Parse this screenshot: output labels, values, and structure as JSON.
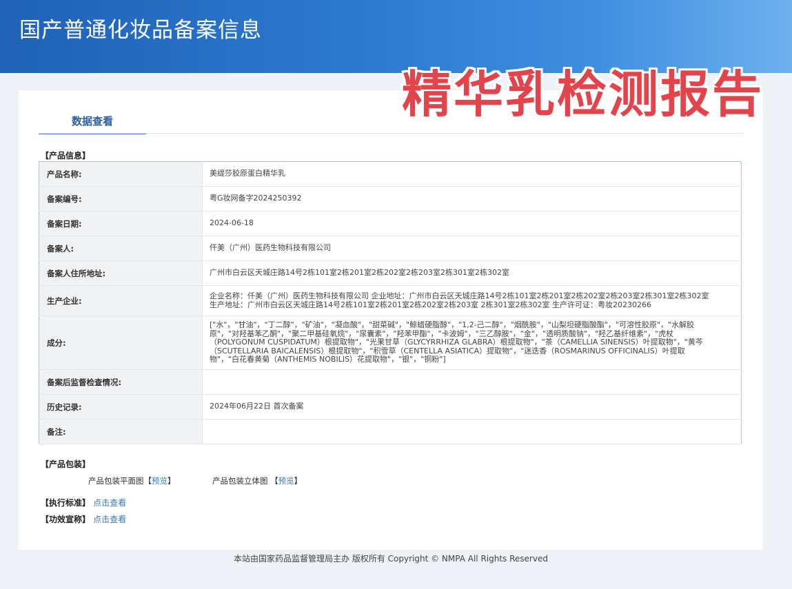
{
  "header": {
    "site_title": "国产普通化妆品备案信息",
    "overlay_text": "精华乳检测报告"
  },
  "tabs": {
    "data_view": "数据查看"
  },
  "product_info": {
    "section_title": "【产品信息】",
    "rows": [
      {
        "label": "产品名称:",
        "value": "美缇莎胶原蛋白精华乳"
      },
      {
        "label": "备案编号:",
        "value": "粤G妆网备字2024250392"
      },
      {
        "label": "备案日期:",
        "value": "2024-06-18"
      },
      {
        "label": "备案人:",
        "value": "仟美（广州）医药生物科技有限公司"
      },
      {
        "label": "备案人住所地址:",
        "value": "广州市白云区天城庄路14号2栋101室2栋201室2栋202室2栋203室2栋301室2栋302室"
      },
      {
        "label": "生产企业:",
        "value": "企业名称：仟美（广州）医药生物科技有限公司 企业地址：广州市白云区天城庄路14号2栋101室2栋201室2栋202室2栋203室2栋301室2栋302室 生产地址：广州市白云区天城庄路14号2栋101室2栋201室2栋202室2栋203室 2栋301室2栋302室 生产许可证：粤妆20230266"
      },
      {
        "label": "成分:",
        "value": "[\"水\"，\"甘油\"，\"丁二醇\"，\"矿油\"，\"凝血酸\"，\"甜菜碱\"，\"鲸蜡硬脂醇\"，\"1,2-己二醇\"，\"烟酰胺\"，\"山梨坦硬脂酸酯\"，\"可溶性胶原\"，\"水解胶原\"，\"对羟基苯乙酮\"，\"聚二甲基硅氧烷\"，\"尿囊素\"，\"羟苯甲酯\"，\"卡波姆\"，\"三乙醇胺\"，\"金\"，\"透明质酸钠\"，\"羟乙基纤维素\"，\"虎杖（POLYGONUM CUSPIDATUM）根提取物\"，\"光果甘草（GLYCYRRHIZA GLABRA）根提取物\"，\"茶（CAMELLIA SINENSIS）叶提取物\"，\"黄芩（SCUTELLARIA BAICALENSIS）根提取物\"，\"积雪草（CENTELLA ASIATICA）提取物\"，\"迷迭香（ROSMARINUS OFFICINALIS）叶提取物\"，\"白花春黄菊（ANTHEMIS NOBILIS）花提取物\"，\"银\"，\"铜粉\"]"
      },
      {
        "label": "备案后监督检查情况:",
        "value": ""
      },
      {
        "label": "历史记录:",
        "value": "2024年06月22日 首次备案"
      },
      {
        "label": "备注:",
        "value": ""
      }
    ]
  },
  "packaging": {
    "section_title": "【产品包装】",
    "flat_label": "产品包装平面图",
    "stereo_label": "产品包装立体图",
    "bracket_open": "【",
    "bracket_close": "】",
    "preview": "预览"
  },
  "standard": {
    "section_title": "【执行标准】",
    "link": "点击查看"
  },
  "efficacy": {
    "section_title": "【功效宣称】",
    "link": "点击查看"
  },
  "footer": {
    "text": "本站由国家药品监督管理局主办 版权所有 Copyright © NMPA All Rights Reserved"
  }
}
